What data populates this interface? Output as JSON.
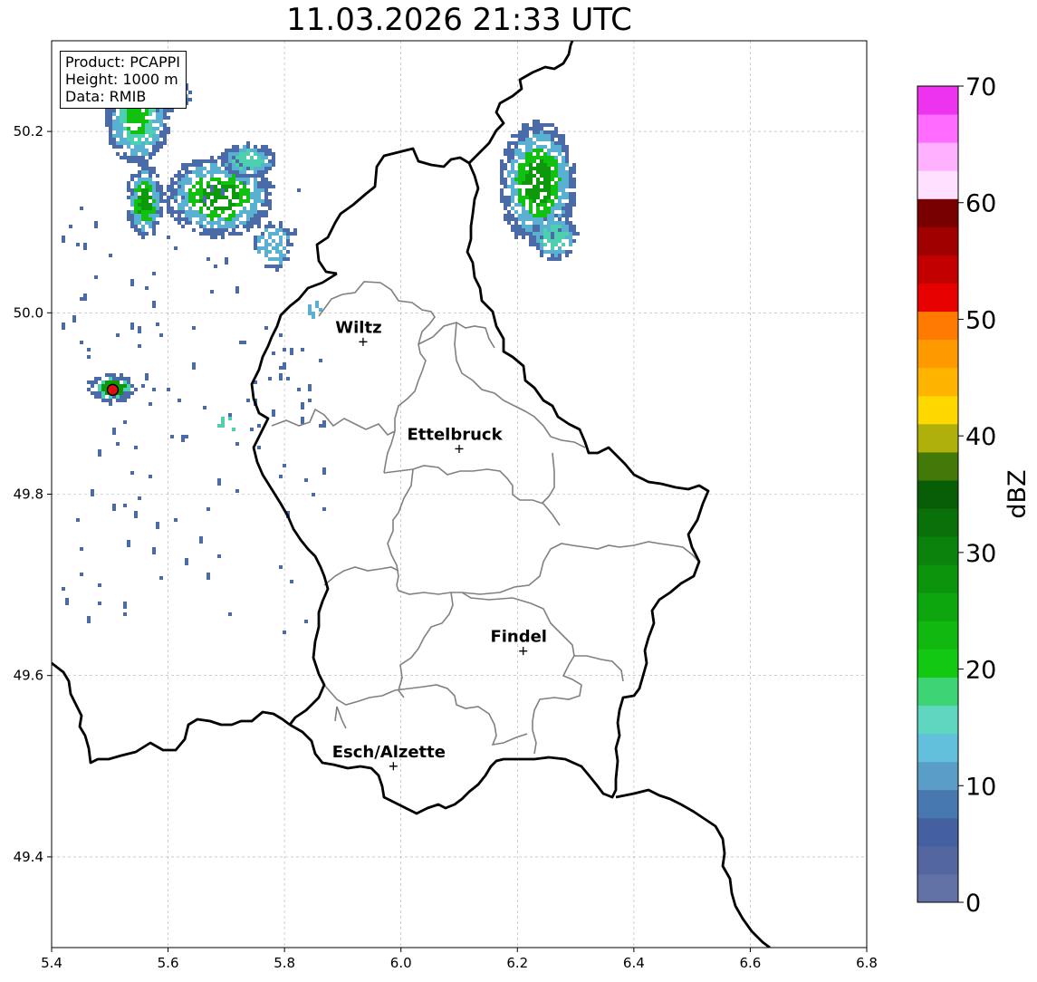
{
  "title": "11.03.2026 21:33 UTC",
  "info_box": {
    "product": "Product: PCAPPI",
    "height": "Height: 1000 m",
    "data": "Data: RMIB"
  },
  "axes": {
    "x_ticks": [
      "5.4",
      "5.6",
      "5.8",
      "6.0",
      "6.2",
      "6.4",
      "6.6",
      "6.8"
    ],
    "y_ticks": [
      "49.4",
      "49.6",
      "49.8",
      "50.0",
      "50.2"
    ],
    "xlim": [
      5.4,
      6.8
    ],
    "ylim": [
      49.3,
      50.3
    ],
    "grid": true
  },
  "cities": [
    {
      "name": "Wiltz",
      "lon": 5.935,
      "lat": 49.968
    },
    {
      "name": "Ettelbruck",
      "lon": 6.1,
      "lat": 49.85
    },
    {
      "name": "Findel",
      "lon": 6.21,
      "lat": 49.627
    },
    {
      "name": "Esch/Alzette",
      "lon": 5.987,
      "lat": 49.5
    }
  ],
  "radar_site": {
    "lon": 5.505,
    "lat": 49.915,
    "color": "#dd1111"
  },
  "colorbar": {
    "label": "dBZ",
    "ticks": [
      "0",
      "10",
      "20",
      "30",
      "40",
      "50",
      "60",
      "70"
    ],
    "range": [
      0,
      70
    ],
    "colors": [
      "#6272a6",
      "#5466a0",
      "#4560a0",
      "#4878b0",
      "#5a9ec8",
      "#63c0dc",
      "#5fd6c0",
      "#3dd474",
      "#12c812",
      "#10b810",
      "#0ea60e",
      "#0c940c",
      "#0b820b",
      "#0a700a",
      "#075e07",
      "#437a07",
      "#b0b00a",
      "#ffd800",
      "#ffb400",
      "#ff9900",
      "#ff7a00",
      "#e60000",
      "#c30000",
      "#a00000",
      "#790000",
      "#ffe0ff",
      "#ffb0ff",
      "#ff6cff",
      "#ee33ee"
    ]
  },
  "echo_colors": {
    "light": "#4a6aa8",
    "medium": "#5ab0d0",
    "teal": "#4ed0b0",
    "green": "#12c012",
    "dark_green": "#0c9a0c"
  }
}
